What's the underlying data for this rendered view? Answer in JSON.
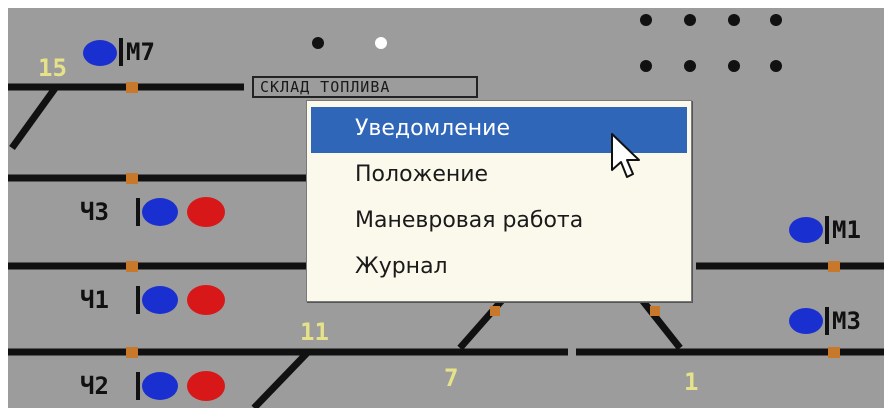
{
  "scheme": {
    "storage_label": "СКЛАД ТОПЛИВА",
    "signals": [
      {
        "name": "M7",
        "lamps": [
          "blue"
        ]
      },
      {
        "name": "Ч3",
        "lamps": [
          "blue",
          "red"
        ]
      },
      {
        "name": "Ч1",
        "lamps": [
          "blue",
          "red"
        ]
      },
      {
        "name": "Ч2",
        "lamps": [
          "blue",
          "red"
        ]
      },
      {
        "name": "M1",
        "lamps": [
          "blue"
        ]
      },
      {
        "name": "M3",
        "lamps": [
          "blue"
        ]
      }
    ],
    "switch_numbers": [
      "15",
      "11",
      "7",
      "1"
    ]
  },
  "context_menu": {
    "items": [
      "Уведомление",
      "Положение",
      "Маневровая работа",
      "Журнал"
    ],
    "selected_index": 0
  },
  "colors": {
    "panel_bg": "#9c9c9c",
    "track": "#111111",
    "insulating_joint": "#c8782a",
    "lamp_blue": "#1a2fd0",
    "lamp_red": "#d81818",
    "switch_number": "#e6e28a",
    "menu_highlight": "#2f66b8"
  }
}
